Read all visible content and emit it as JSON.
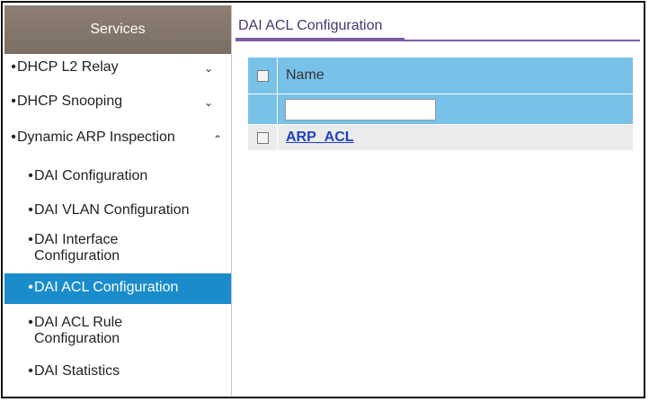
{
  "sidebar": {
    "header": "Services",
    "items": [
      {
        "label": "DHCP L2 Relay",
        "chevron": "chevron-down-icon"
      },
      {
        "label": "DHCP Snooping",
        "chevron": "chevron-down-icon"
      },
      {
        "label": "Dynamic ARP Inspection",
        "chevron": "chevron-up-icon"
      }
    ],
    "sub_items": [
      {
        "label": "DAI Configuration"
      },
      {
        "label": "DAI VLAN Configuration"
      },
      {
        "label": "DAI Interface Configuration"
      },
      {
        "label": "DAI ACL Configuration",
        "active": true
      },
      {
        "label": "DAI ACL Rule Configuration"
      },
      {
        "label": "DAI Statistics"
      }
    ],
    "bullet": "•",
    "active_color": "#1a8ccc"
  },
  "main": {
    "title": "DAI ACL Configuration",
    "table": {
      "column_name": "Name",
      "filter_value": "",
      "rows": [
        {
          "name": "ARP_ACL"
        }
      ]
    }
  }
}
